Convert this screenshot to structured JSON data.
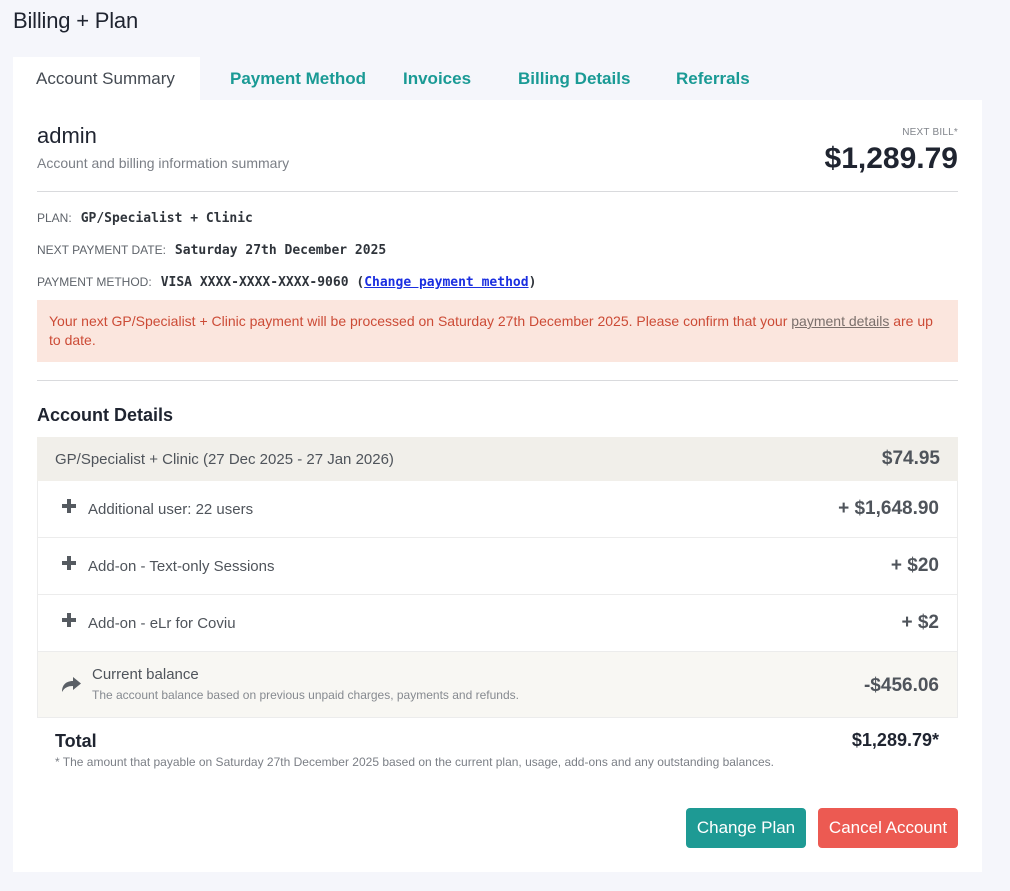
{
  "page": {
    "title": "Billing + Plan"
  },
  "tabs": [
    {
      "label": "Account Summary",
      "active": true
    },
    {
      "label": "Payment Method",
      "active": false
    },
    {
      "label": "Invoices",
      "active": false
    },
    {
      "label": "Billing Details",
      "active": false
    },
    {
      "label": "Referrals",
      "active": false
    }
  ],
  "account": {
    "name": "admin",
    "subtitle": "Account and billing information summary",
    "next_bill_label": "NEXT BILL*",
    "next_bill_amount": "$1,289.79"
  },
  "info": {
    "plan_label": "PLAN:",
    "plan_value": "GP/Specialist + Clinic",
    "next_payment_label": "NEXT PAYMENT DATE:",
    "next_payment_value": "Saturday 27th December 2025",
    "payment_method_label": "PAYMENT METHOD:",
    "payment_method_value": "VISA XXXX-XXXX-XXXX-9060",
    "paren_open": "(",
    "change_link": "Change payment method",
    "paren_close": ")"
  },
  "alert": {
    "text": "Your next GP/Specialist + Clinic payment will be processed on Saturday 27th December 2025. Please confirm that your ",
    "link": "payment details",
    "text_end": " are up to date."
  },
  "details": {
    "title": "Account Details",
    "plan_row": {
      "label": "GP/Specialist + Clinic (27 Dec 2025 - 27 Jan 2026)",
      "amount": "$74.95"
    },
    "items": [
      {
        "label": "Additional user: 22 users",
        "amount": "+ $1,648.90",
        "icon": "plus-icon"
      },
      {
        "label": "Add-on - Text-only Sessions",
        "amount": "+ $20",
        "icon": "plus-icon"
      },
      {
        "label": "Add-on - eLr for Coviu",
        "amount": "+ $2",
        "icon": "plus-icon"
      }
    ],
    "balance": {
      "label": "Current balance",
      "sublabel": "The account balance based on previous unpaid charges, payments and refunds.",
      "amount": "-$456.06",
      "icon": "share-arrow-icon"
    }
  },
  "total": {
    "label": "Total",
    "amount": "$1,289.79*",
    "note": "* The amount that payable on Saturday 27th December 2025 based on the current plan, usage, add-ons and any outstanding balances."
  },
  "buttons": {
    "change_plan": "Change Plan",
    "cancel_account": "Cancel Account"
  },
  "colors": {
    "accent": "#1e9a94",
    "danger": "#ec5a52",
    "alert_bg": "#fbe6de",
    "alert_text": "#cc4b36"
  }
}
